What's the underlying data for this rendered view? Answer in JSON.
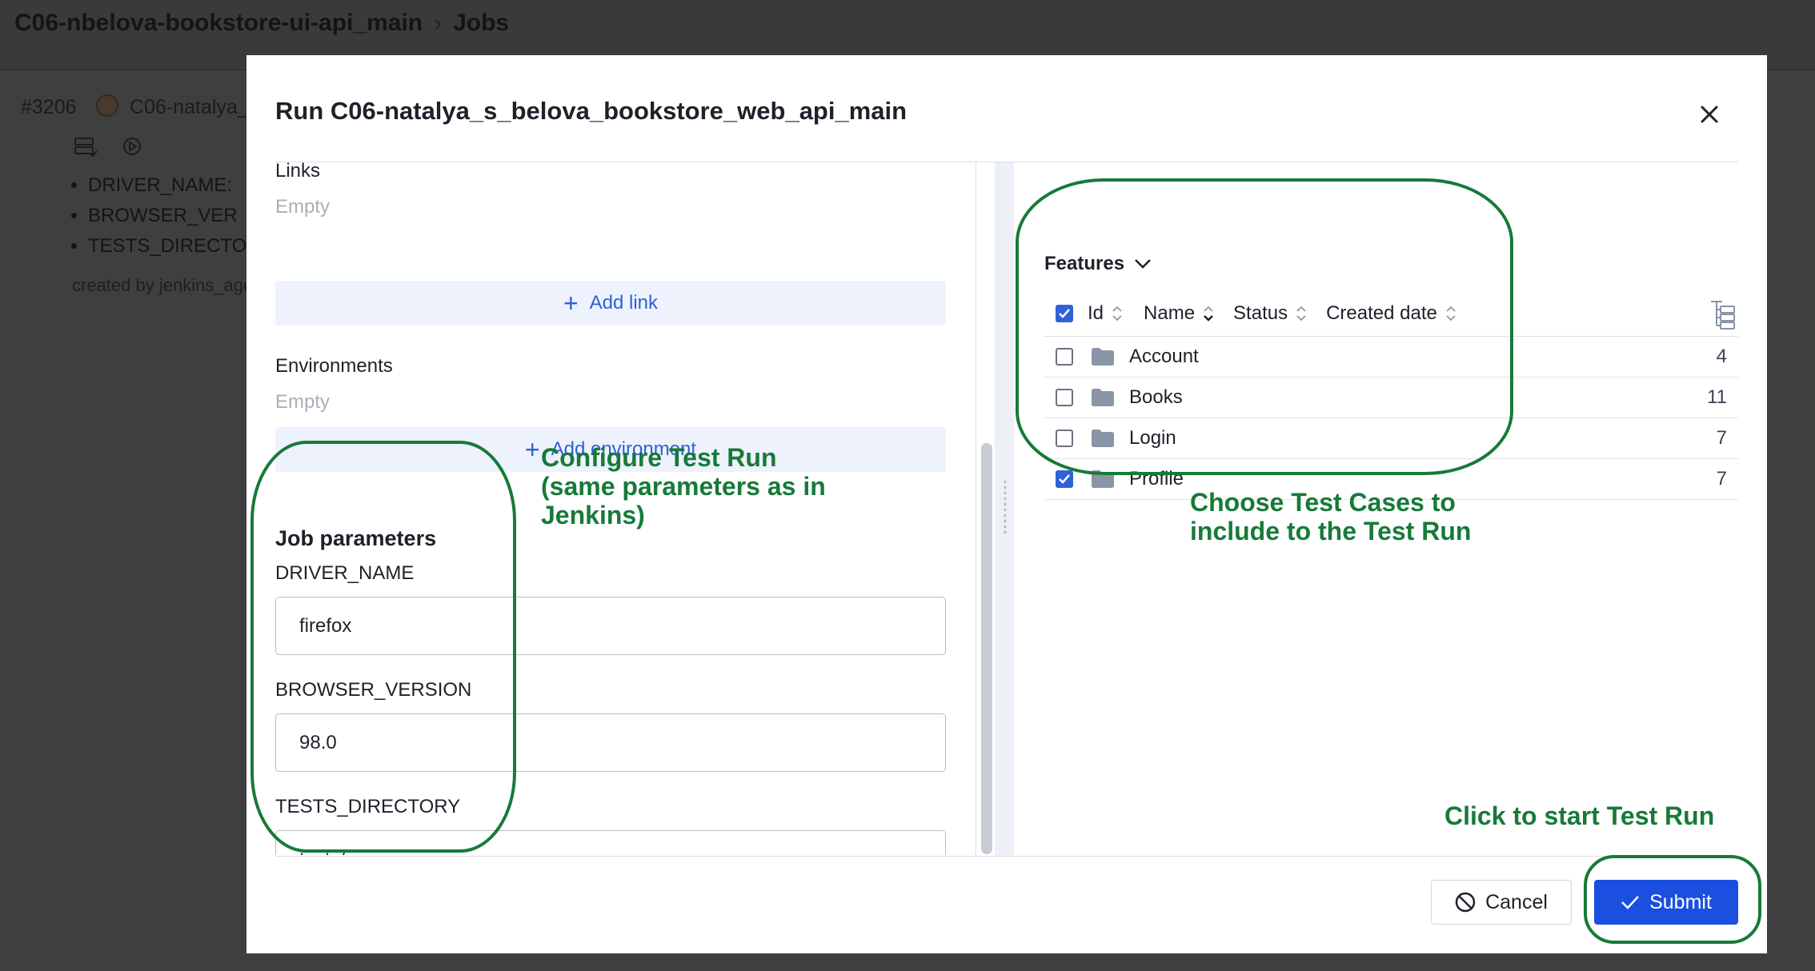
{
  "background": {
    "breadcrumb": {
      "project": "C06-nbelova-bookstore-ui-api_main",
      "separator": "›",
      "section": "Jobs"
    },
    "job_number": "#3206",
    "user": "C06-natalya_",
    "params_list": [
      "DRIVER_NAME:",
      "BROWSER_VER",
      "TESTS_DIRECTO"
    ],
    "created_by": "created by jenkins_age"
  },
  "modal": {
    "title": "Run C06-natalya_s_belova_bookstore_web_api_main",
    "close_icon": "close-icon",
    "links": {
      "label": "Links",
      "empty": "Empty",
      "add_label": "Add link"
    },
    "environments": {
      "label": "Environments",
      "empty": "Empty",
      "add_label": "Add environment"
    },
    "job_parameters": {
      "title": "Job parameters",
      "params": [
        {
          "label": "DRIVER_NAME",
          "value": "firefox"
        },
        {
          "label": "BROWSER_VERSION",
          "value": "98.0"
        },
        {
          "label": "TESTS_DIRECTORY",
          "value": "tests/"
        }
      ]
    },
    "features": {
      "dropdown_label": "Features",
      "columns": [
        "Id",
        "Name",
        "Status",
        "Created date"
      ],
      "header_checked": true,
      "rows": [
        {
          "name": "Account",
          "count": "4",
          "checked": false
        },
        {
          "name": "Books",
          "count": "11",
          "checked": false
        },
        {
          "name": "Login",
          "count": "7",
          "checked": false
        },
        {
          "name": "Profile",
          "count": "7",
          "checked": true
        }
      ]
    },
    "footer": {
      "cancel_label": "Cancel",
      "submit_label": "Submit"
    }
  },
  "annotations": {
    "configure_line1": "Configure Test Run",
    "configure_line2": "(same parameters as in",
    "configure_line3": "Jenkins)",
    "choose_line1": "Choose Test Cases to",
    "choose_line2": "include to the Test Run",
    "click_text": "Click to start Test Run"
  },
  "colors": {
    "accent": "#1b4fe0",
    "annotation": "#177a38",
    "link_blue": "#2e61d6",
    "overlay": "#3f3f3f"
  }
}
